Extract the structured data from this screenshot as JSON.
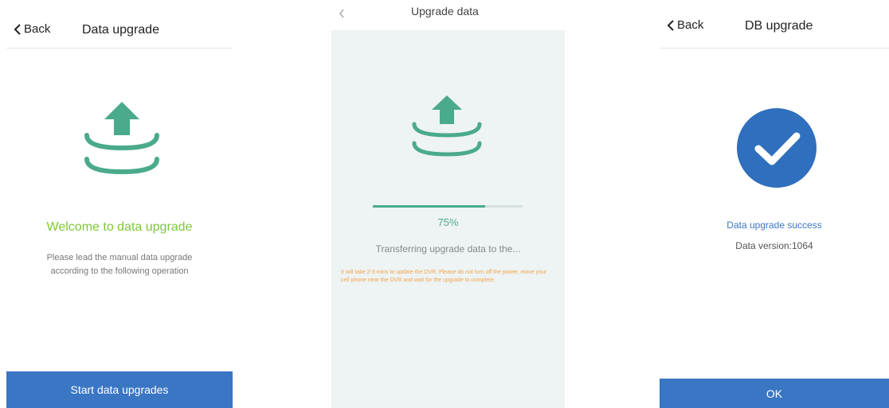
{
  "colors": {
    "accent_green": "#4aaa8c",
    "title_green": "#7dc83a",
    "primary_blue": "#3a76c4",
    "warning_orange": "#f2a54c"
  },
  "screen1": {
    "back_label": "Back",
    "title": "Data upgrade",
    "icon": "upload-data-icon",
    "welcome": "Welcome to data upgrade",
    "instructions_line1": "Please lead the manual data upgrade",
    "instructions_line2": "according to the following operation",
    "button_label": "Start data upgrades"
  },
  "screen2": {
    "title": "Upgrade data",
    "icon": "upload-data-icon",
    "progress": 0.75,
    "progress_text": "75%",
    "status": "Transferring upgrade data to the...",
    "warning": "It will take 2-3 mins to update the DVR. Please do not turn off the power, move your cell phone near the DVR and wait for the upgrade to complete."
  },
  "screen3": {
    "back_label": "Back",
    "title": "DB upgrade",
    "icon": "check-circle-icon",
    "success_text": "Data upgrade success",
    "version_text": "Data version:1064",
    "button_label": "OK"
  }
}
